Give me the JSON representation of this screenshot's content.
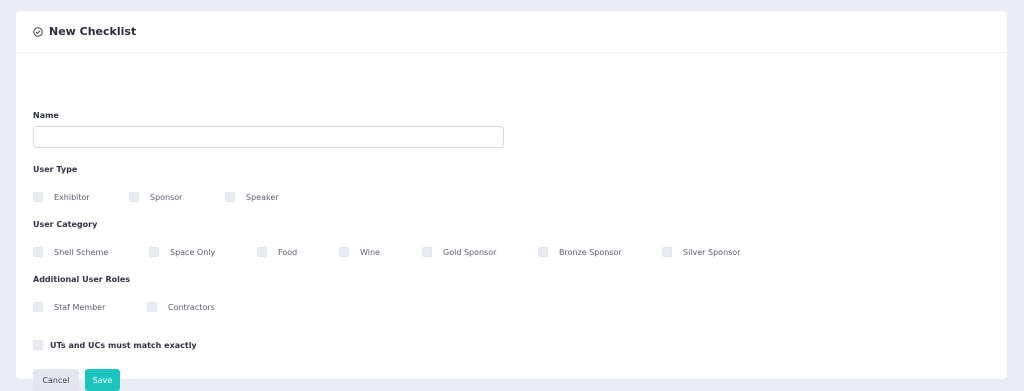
{
  "header": {
    "title": "New Checklist",
    "icon": "check-circle-icon"
  },
  "form": {
    "name_label": "Name",
    "name_value": "",
    "name_placeholder": "",
    "user_type": {
      "label": "User Type",
      "options": [
        "Exhibitor",
        "Sponsor",
        "Speaker"
      ]
    },
    "user_category": {
      "label": "User Category",
      "options": [
        "Shell Scheme",
        "Space Only",
        "Food",
        "Wine",
        "Gold Sponsor",
        "Bronze Sponsor",
        "Silver Sponsor"
      ]
    },
    "additional_roles": {
      "label": "Additional User Roles",
      "options": [
        "Staf Member",
        "Contractors"
      ]
    },
    "match_exactly_label": "UTs and UCs must match exactly"
  },
  "buttons": {
    "cancel": "Cancel",
    "save": "Save"
  },
  "colors": {
    "accent": "#1bc5bd",
    "background": "#e9ecf5",
    "cancel_bg": "#e4e6ef"
  }
}
